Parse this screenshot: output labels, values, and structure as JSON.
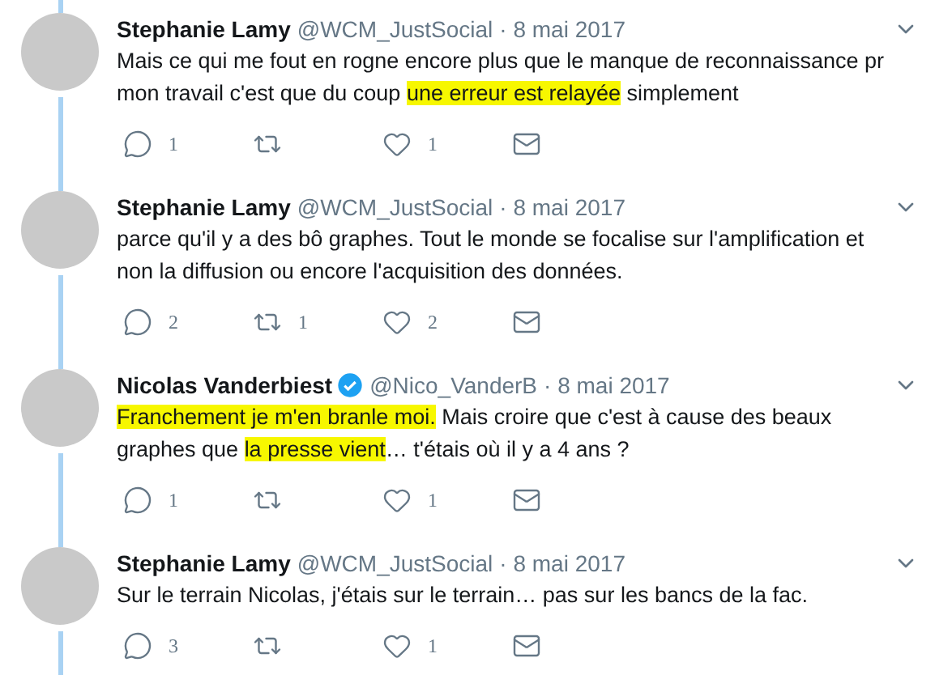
{
  "tweets": [
    {
      "name": "Stephanie Lamy",
      "verified": false,
      "handle": "@WCM_JustSocial",
      "date": "· 8 mai 2017",
      "text": [
        {
          "t": "Mais ce qui me fout en rogne encore plus que le manque de reconnaissance pr mon travail c'est que du coup ",
          "highlighted": false
        },
        {
          "t": "une erreur est relayée",
          "highlighted": true
        },
        {
          "t": " simplement",
          "highlighted": false
        }
      ],
      "replies": "1",
      "likes": "1"
    },
    {
      "name": "Stephanie Lamy",
      "verified": false,
      "handle": "@WCM_JustSocial",
      "date": "· 8 mai 2017",
      "text": [
        {
          "t": "parce qu'il y a des bô graphes. Tout le monde se focalise sur l'amplification et non la diffusion ou encore l'acquisition des données.",
          "highlighted": false
        }
      ],
      "replies": "2",
      "retweets": "1",
      "likes": "2"
    },
    {
      "name": "Nicolas Vanderbiest",
      "verified": true,
      "handle": "@Nico_VanderB",
      "date": "· 8 mai 2017",
      "text": [
        {
          "t": "Franchement je m'en branle moi.",
          "highlighted": true
        },
        {
          "t": " Mais croire que c'est à cause des beaux graphes que ",
          "highlighted": false
        },
        {
          "t": "la presse vient",
          "highlighted": true
        },
        {
          "t": "… t'étais où il y a 4 ans ?",
          "highlighted": false
        }
      ],
      "replies": "1",
      "likes": "1"
    },
    {
      "name": "Stephanie Lamy",
      "verified": false,
      "handle": "@WCM_JustSocial",
      "date": "· 8 mai 2017",
      "text": [
        {
          "t": "Sur le terrain Nicolas, j'étais sur le terrain… pas sur les bancs de la fac.",
          "highlighted": false
        }
      ],
      "replies": "3",
      "likes": "1"
    }
  ]
}
